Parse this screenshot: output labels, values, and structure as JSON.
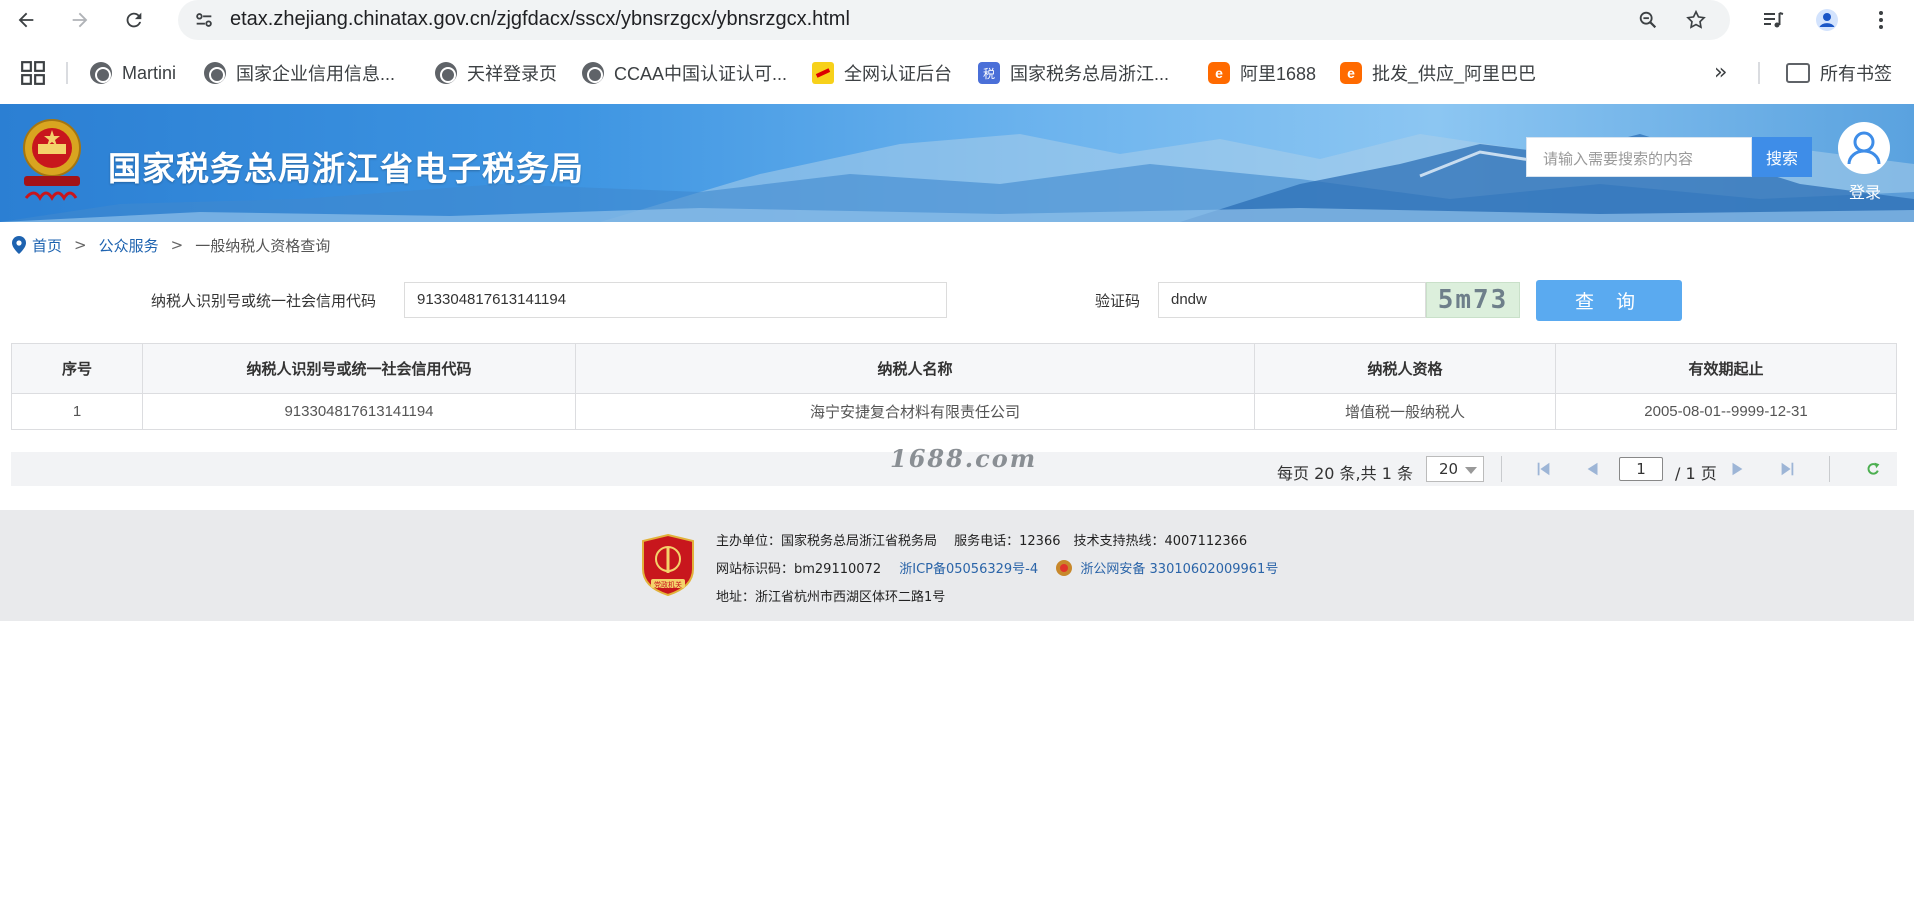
{
  "browser": {
    "url": "etax.zhejiang.chinatax.gov.cn/zjgfdacx/sscx/ybnsrzgcx/ybnsrzgcx.html",
    "bookmarks": [
      {
        "label": "Martini",
        "icon": "globe"
      },
      {
        "label": "国家企业信用信息...",
        "icon": "globe"
      },
      {
        "label": "天祥登录页",
        "icon": "globe"
      },
      {
        "label": "CCAA中国认证认可...",
        "icon": "globe"
      },
      {
        "label": "全网认证后台",
        "icon": "enterprise"
      },
      {
        "label": "国家税务总局浙江...",
        "icon": "tax"
      },
      {
        "label": "阿里1688",
        "icon": "alibaba"
      },
      {
        "label": "批发_供应_阿里巴巴",
        "icon": "alibaba"
      }
    ],
    "more": "»",
    "all_bookmarks": "所有书签",
    "colors": {
      "chrome_bg": "#ffffff",
      "omnibox_bg": "#f1f3f4"
    }
  },
  "site": {
    "title": "国家税务总局浙江省电子税务局",
    "search_placeholder": "请输入需要搜索的内容",
    "search_button": "搜索",
    "login_label": "登录",
    "colors": {
      "accent": "#3e8de8",
      "banner": "#3e95e2"
    }
  },
  "breadcrumb": {
    "home": "首页",
    "public_service": "公众服务",
    "current": "一般纳税人资格查询",
    "separator": ">"
  },
  "form": {
    "taxpayer_id_label": "纳税人识别号或统一社会信用代码",
    "taxpayer_id_value": "913304817613141194",
    "captcha_label": "验证码",
    "captcha_value": "dndw",
    "captcha_image_text": "5m73",
    "query_button": "查 询"
  },
  "table": {
    "headers": [
      "序号",
      "纳税人识别号或统一社会信用代码",
      "纳税人名称",
      "纳税人资格",
      "有效期起止"
    ],
    "rows": [
      [
        "1",
        "913304817613141194",
        "海宁安捷复合材料有限责任公司",
        "增值税一般纳税人",
        "2005-08-01--9999-12-31"
      ]
    ]
  },
  "pager": {
    "summary": "每页 20 条,共 1 条",
    "page_size": "20",
    "current_page": "1",
    "total_pages": "/ 1 页",
    "watermark": "1688.com"
  },
  "footer": {
    "line1": "主办单位：国家税务总局浙江省税务局　 服务电话：12366　技术支持热线：4007112366",
    "site_code": "网站标识码：bm29110072",
    "icp": "浙ICP备05056329号-4",
    "police": "浙公网安备 33010602009961号",
    "address": "地址：浙江省杭州市西湖区体环二路1号",
    "badge_text": "党政机关"
  }
}
